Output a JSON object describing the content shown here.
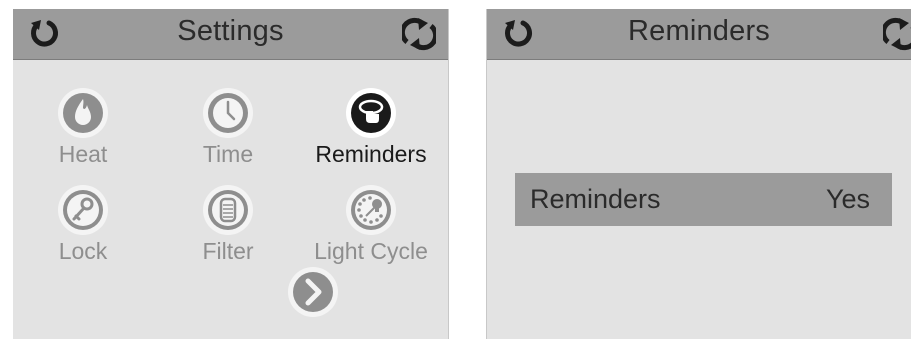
{
  "left_panel": {
    "title": "Settings",
    "back_icon": "back-arrow-icon",
    "sync_icon": "sync-icon",
    "items": [
      {
        "label": "Heat",
        "icon": "flame-icon"
      },
      {
        "label": "Time",
        "icon": "clock-icon"
      },
      {
        "label": "Reminders",
        "icon": "reminder-icon",
        "active": true
      },
      {
        "label": "Lock",
        "icon": "key-icon"
      },
      {
        "label": "Filter",
        "icon": "filter-icon"
      },
      {
        "label": "Light Cycle",
        "icon": "light-cycle-icon"
      }
    ],
    "next_icon": "chevron-right-icon"
  },
  "right_panel": {
    "title": "Reminders",
    "back_icon": "back-arrow-icon",
    "sync_icon": "sync-icon",
    "row": {
      "label": "Reminders",
      "value": "Yes"
    }
  },
  "colors": {
    "panel_bg": "#e3e3e3",
    "header_bg": "#9b9b9b",
    "inactive_text": "#8e8e8e",
    "active_text": "#1a1a1a"
  }
}
